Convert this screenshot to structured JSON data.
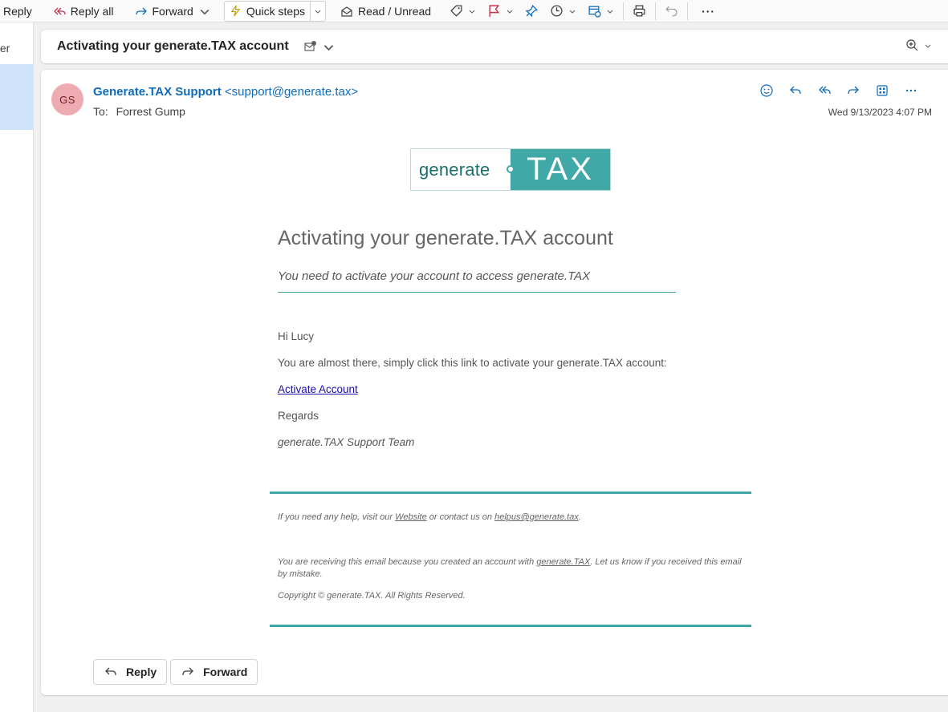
{
  "toolbar": {
    "reply_label": "Reply",
    "reply_all_label": "Reply all",
    "forward_label": "Forward",
    "quick_steps_label": "Quick steps",
    "read_unread_label": "Read / Unread",
    "more_label": "···"
  },
  "left_pane": {
    "cut_text": "ter"
  },
  "subject": {
    "title": "Activating your generate.TAX account"
  },
  "message": {
    "avatar_initials": "GS",
    "sender_name": "Generate.TAX Support",
    "sender_address": "<support@generate.tax>",
    "to_label": "To:",
    "to_value": "Forrest Gump",
    "date": "Wed 9/13/2023 4:07 PM"
  },
  "email_body": {
    "logo_left": "generate",
    "logo_right": "TAX",
    "heading": "Activating your generate.TAX account",
    "subheading": "You need to activate your account to access generate.TAX",
    "greeting": "Hi Lucy",
    "intro": "You are almost there, simply click this link to activate your generate.TAX account:",
    "activate_link": "Activate Account",
    "regards": "Regards",
    "signature": "generate.TAX Support Team",
    "help_prefix": "If you need any help, visit our ",
    "help_website": "Website",
    "help_middle": " or contact us on ",
    "help_email": "helpus@generate.tax",
    "help_suffix": ".",
    "notice_prefix": "You are receiving this email because you created an account with ",
    "notice_link": "generate.TAX",
    "notice_suffix": ". Let us know if you received this email by mistake.",
    "copyright": "Copyright © generate.TAX. All Rights Reserved."
  },
  "footer_buttons": {
    "reply": "Reply",
    "forward": "Forward"
  },
  "colors": {
    "accent": "#0f6cbd",
    "brand_teal": "#40a9a8",
    "avatar_bg": "#eeacb2",
    "selection": "#cfe4fa"
  }
}
